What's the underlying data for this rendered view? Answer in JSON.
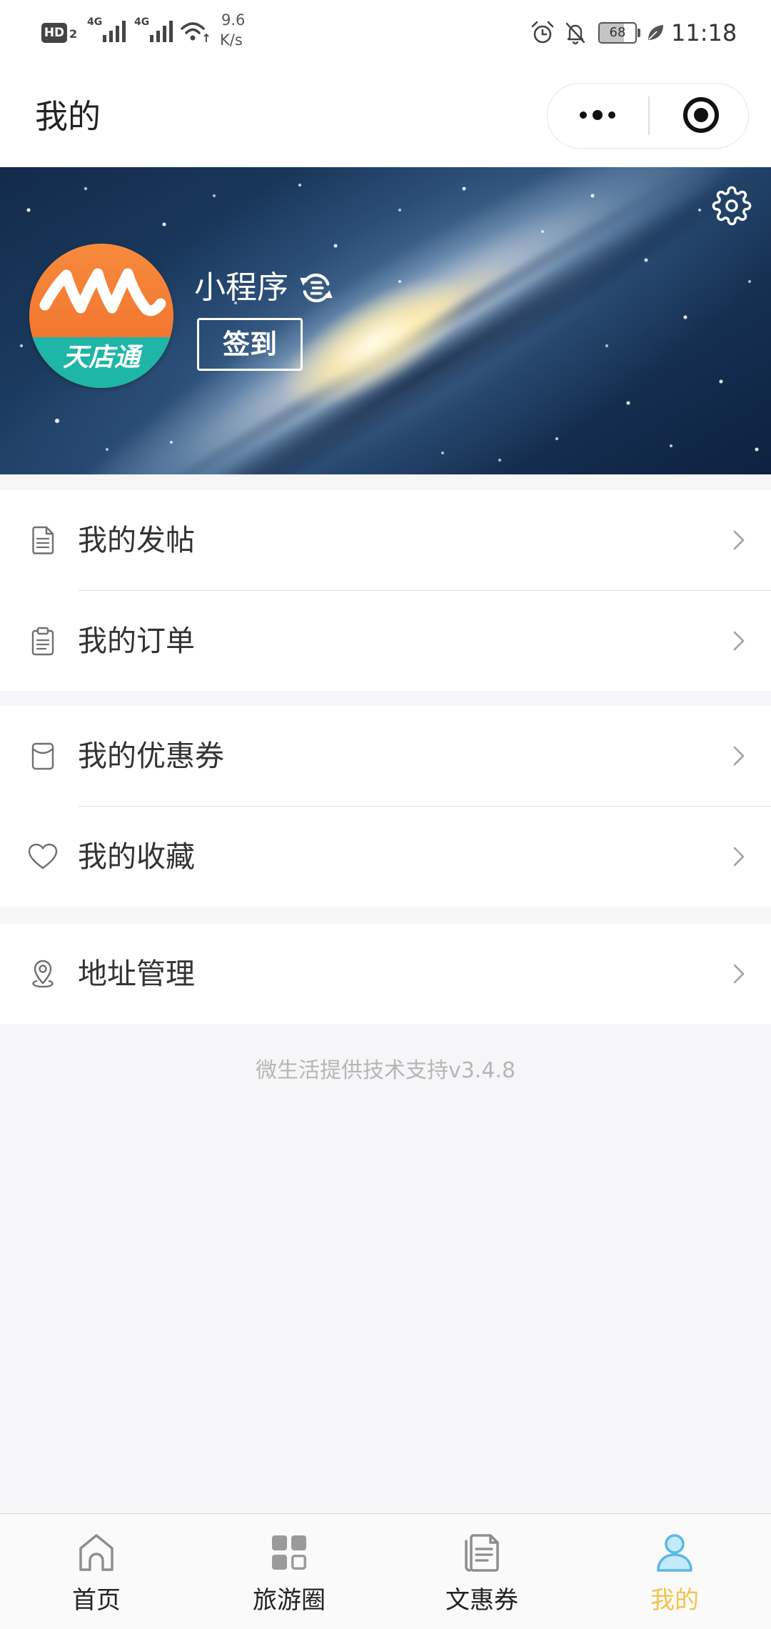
{
  "status_bar": {
    "hd_badge": "HD",
    "sim_slot": "2",
    "network_1": "4G",
    "network_2": "4G",
    "speed_value": "9.6",
    "speed_unit": "K/s",
    "battery_level": "68",
    "battery_fraction": 0.68,
    "time": "11:18",
    "icons": [
      "signal-icon",
      "wifi-icon",
      "alarm-icon",
      "bell-muted-icon",
      "battery-icon",
      "leaf-icon"
    ]
  },
  "header": {
    "title": "我的",
    "capsule": {
      "more_icon": "more-dots-icon",
      "close_icon": "target-circle-icon"
    }
  },
  "profile": {
    "avatar_logo_text": "天店通",
    "name": "小程序",
    "switch_icon": "refresh-switch-icon",
    "checkin_label": "签到",
    "settings_icon": "gear-icon"
  },
  "menu_groups": [
    {
      "items": [
        {
          "label": "我的发帖",
          "icon": "document-icon"
        },
        {
          "label": "我的订单",
          "icon": "clipboard-icon"
        }
      ]
    },
    {
      "items": [
        {
          "label": "我的优惠券",
          "icon": "coupon-bag-icon"
        },
        {
          "label": "我的收藏",
          "icon": "heart-icon"
        }
      ]
    },
    {
      "items": [
        {
          "label": "地址管理",
          "icon": "location-pin-icon"
        }
      ]
    }
  ],
  "footer": {
    "support_text": "微生活提供技术支持v3.4.8"
  },
  "tabbar": {
    "items": [
      {
        "label": "首页",
        "icon": "home-icon",
        "active": false
      },
      {
        "label": "旅游圈",
        "icon": "grid-icon",
        "active": false
      },
      {
        "label": "文惠券",
        "icon": "ticket-document-icon",
        "active": false
      },
      {
        "label": "我的",
        "icon": "person-icon",
        "active": true
      }
    ]
  },
  "colors": {
    "page_background": "#f6f6f8",
    "text_primary": "#333333",
    "footer_text": "#b6b6b6",
    "tab_active_label": "#f2c44b",
    "tab_active_icon": "#5ab9e6",
    "tab_inactive_icon": "#8e8e8e",
    "avatar_orange": "#f27a30",
    "avatar_teal": "#1eb6a6"
  }
}
